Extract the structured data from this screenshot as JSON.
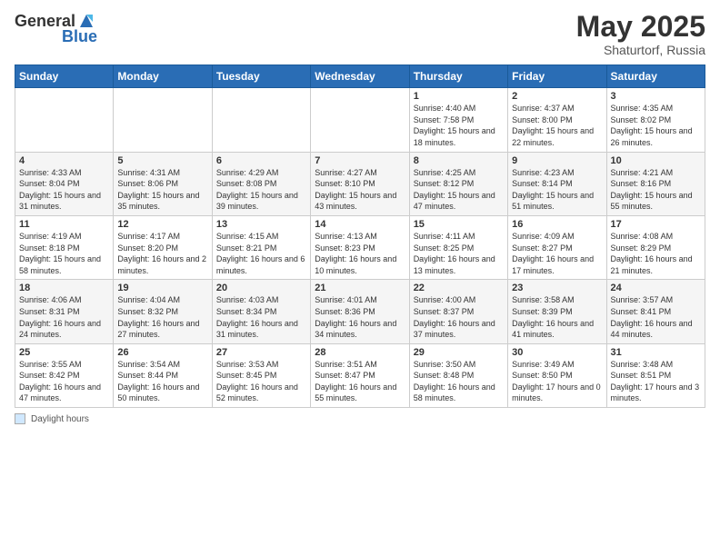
{
  "header": {
    "logo_general": "General",
    "logo_blue": "Blue",
    "title": "May 2025",
    "subtitle": "Shaturtorf, Russia"
  },
  "days_of_week": [
    "Sunday",
    "Monday",
    "Tuesday",
    "Wednesday",
    "Thursday",
    "Friday",
    "Saturday"
  ],
  "weeks": [
    [
      {
        "day": "",
        "info": ""
      },
      {
        "day": "",
        "info": ""
      },
      {
        "day": "",
        "info": ""
      },
      {
        "day": "",
        "info": ""
      },
      {
        "day": "1",
        "info": "Sunrise: 4:40 AM\nSunset: 7:58 PM\nDaylight: 15 hours and 18 minutes."
      },
      {
        "day": "2",
        "info": "Sunrise: 4:37 AM\nSunset: 8:00 PM\nDaylight: 15 hours and 22 minutes."
      },
      {
        "day": "3",
        "info": "Sunrise: 4:35 AM\nSunset: 8:02 PM\nDaylight: 15 hours and 26 minutes."
      }
    ],
    [
      {
        "day": "4",
        "info": "Sunrise: 4:33 AM\nSunset: 8:04 PM\nDaylight: 15 hours and 31 minutes."
      },
      {
        "day": "5",
        "info": "Sunrise: 4:31 AM\nSunset: 8:06 PM\nDaylight: 15 hours and 35 minutes."
      },
      {
        "day": "6",
        "info": "Sunrise: 4:29 AM\nSunset: 8:08 PM\nDaylight: 15 hours and 39 minutes."
      },
      {
        "day": "7",
        "info": "Sunrise: 4:27 AM\nSunset: 8:10 PM\nDaylight: 15 hours and 43 minutes."
      },
      {
        "day": "8",
        "info": "Sunrise: 4:25 AM\nSunset: 8:12 PM\nDaylight: 15 hours and 47 minutes."
      },
      {
        "day": "9",
        "info": "Sunrise: 4:23 AM\nSunset: 8:14 PM\nDaylight: 15 hours and 51 minutes."
      },
      {
        "day": "10",
        "info": "Sunrise: 4:21 AM\nSunset: 8:16 PM\nDaylight: 15 hours and 55 minutes."
      }
    ],
    [
      {
        "day": "11",
        "info": "Sunrise: 4:19 AM\nSunset: 8:18 PM\nDaylight: 15 hours and 58 minutes."
      },
      {
        "day": "12",
        "info": "Sunrise: 4:17 AM\nSunset: 8:20 PM\nDaylight: 16 hours and 2 minutes."
      },
      {
        "day": "13",
        "info": "Sunrise: 4:15 AM\nSunset: 8:21 PM\nDaylight: 16 hours and 6 minutes."
      },
      {
        "day": "14",
        "info": "Sunrise: 4:13 AM\nSunset: 8:23 PM\nDaylight: 16 hours and 10 minutes."
      },
      {
        "day": "15",
        "info": "Sunrise: 4:11 AM\nSunset: 8:25 PM\nDaylight: 16 hours and 13 minutes."
      },
      {
        "day": "16",
        "info": "Sunrise: 4:09 AM\nSunset: 8:27 PM\nDaylight: 16 hours and 17 minutes."
      },
      {
        "day": "17",
        "info": "Sunrise: 4:08 AM\nSunset: 8:29 PM\nDaylight: 16 hours and 21 minutes."
      }
    ],
    [
      {
        "day": "18",
        "info": "Sunrise: 4:06 AM\nSunset: 8:31 PM\nDaylight: 16 hours and 24 minutes."
      },
      {
        "day": "19",
        "info": "Sunrise: 4:04 AM\nSunset: 8:32 PM\nDaylight: 16 hours and 27 minutes."
      },
      {
        "day": "20",
        "info": "Sunrise: 4:03 AM\nSunset: 8:34 PM\nDaylight: 16 hours and 31 minutes."
      },
      {
        "day": "21",
        "info": "Sunrise: 4:01 AM\nSunset: 8:36 PM\nDaylight: 16 hours and 34 minutes."
      },
      {
        "day": "22",
        "info": "Sunrise: 4:00 AM\nSunset: 8:37 PM\nDaylight: 16 hours and 37 minutes."
      },
      {
        "day": "23",
        "info": "Sunrise: 3:58 AM\nSunset: 8:39 PM\nDaylight: 16 hours and 41 minutes."
      },
      {
        "day": "24",
        "info": "Sunrise: 3:57 AM\nSunset: 8:41 PM\nDaylight: 16 hours and 44 minutes."
      }
    ],
    [
      {
        "day": "25",
        "info": "Sunrise: 3:55 AM\nSunset: 8:42 PM\nDaylight: 16 hours and 47 minutes."
      },
      {
        "day": "26",
        "info": "Sunrise: 3:54 AM\nSunset: 8:44 PM\nDaylight: 16 hours and 50 minutes."
      },
      {
        "day": "27",
        "info": "Sunrise: 3:53 AM\nSunset: 8:45 PM\nDaylight: 16 hours and 52 minutes."
      },
      {
        "day": "28",
        "info": "Sunrise: 3:51 AM\nSunset: 8:47 PM\nDaylight: 16 hours and 55 minutes."
      },
      {
        "day": "29",
        "info": "Sunrise: 3:50 AM\nSunset: 8:48 PM\nDaylight: 16 hours and 58 minutes."
      },
      {
        "day": "30",
        "info": "Sunrise: 3:49 AM\nSunset: 8:50 PM\nDaylight: 17 hours and 0 minutes."
      },
      {
        "day": "31",
        "info": "Sunrise: 3:48 AM\nSunset: 8:51 PM\nDaylight: 17 hours and 3 minutes."
      }
    ]
  ],
  "footer": {
    "label": "Daylight hours"
  }
}
